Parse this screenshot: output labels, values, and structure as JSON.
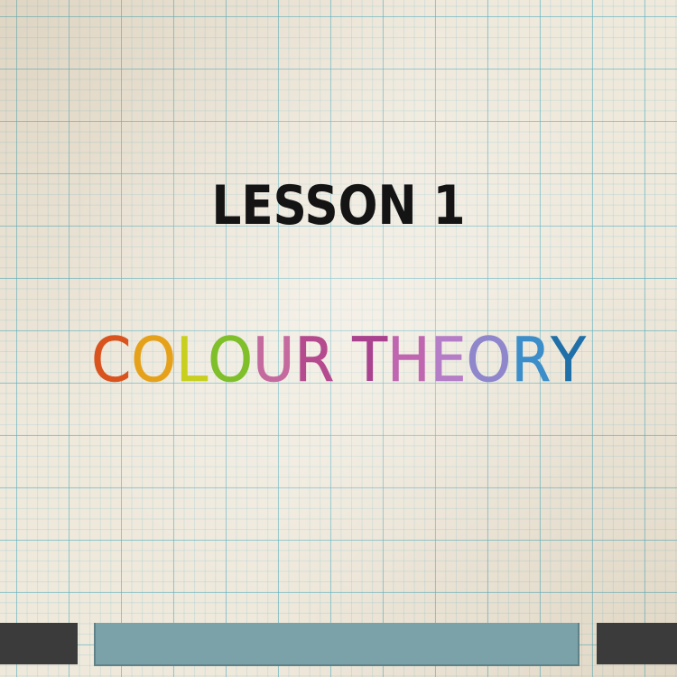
{
  "lesson": {
    "title": "LESSON 1"
  },
  "topic": {
    "title": "COLOUR THEORY",
    "letter_colors": [
      "#d9531e",
      "#e6a11a",
      "#c9cf1f",
      "#7fbf2a",
      "#c56a9f",
      "#b54a8e",
      "#a9428f",
      "#c066b0",
      "#b57dc7",
      "#8f86cc",
      "#3b8ec9",
      "#1f6fa8",
      "#1c2f45"
    ]
  },
  "colors": {
    "paper": "#efe9dc",
    "grid": "#5aafbe",
    "bar": "#7aa2a8",
    "dark_blocks": "#3b3b3b",
    "title_text": "#141414"
  }
}
